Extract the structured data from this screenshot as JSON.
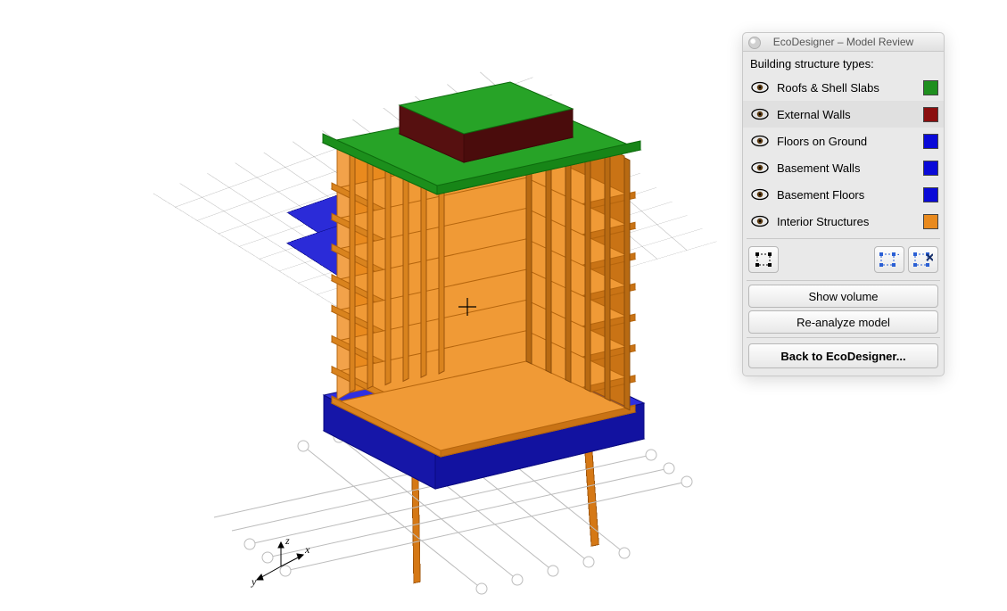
{
  "panel": {
    "title": "EcoDesigner – Model Review",
    "section_label": "Building structure types:",
    "types": [
      {
        "label": "Roofs & Shell Slabs",
        "color": "#1e8f1e",
        "selected": false
      },
      {
        "label": "External Walls",
        "color": "#8b0e0e",
        "selected": true
      },
      {
        "label": "Floors on Ground",
        "color": "#0a0ad8",
        "selected": false
      },
      {
        "label": "Basement Walls",
        "color": "#0a0ad8",
        "selected": false
      },
      {
        "label": "Basement Floors",
        "color": "#0a0ad8",
        "selected": false
      },
      {
        "label": "Interior Structures",
        "color": "#e98a1e",
        "selected": false
      }
    ],
    "tool_icons": {
      "left": "selection-tool-icon",
      "right1": "select-matching-icon",
      "right2": "select-inverse-icon"
    },
    "buttons": {
      "show_volume": "Show volume",
      "reanalyze": "Re-analyze model",
      "back": "Back to EcoDesigner..."
    }
  },
  "model_colors": {
    "roof": "#1e8f1e",
    "penthouse": "#6a1414",
    "walls": "#e98a1e",
    "slab": "#e98a1e",
    "base": "#2424c8"
  },
  "axes": {
    "x": "x",
    "y": "y",
    "z": "z"
  }
}
